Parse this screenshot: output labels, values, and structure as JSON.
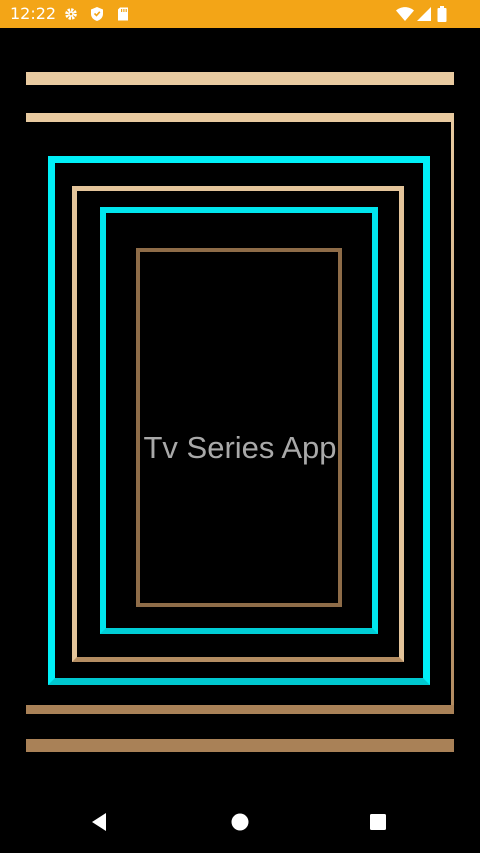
{
  "status_bar": {
    "time": "12:22",
    "background_color": "#f3a517",
    "left_icons": [
      "gear-icon",
      "shield-icon",
      "sd-card-icon"
    ],
    "right_icons": [
      "wifi-icon",
      "cell-signal-icon",
      "battery-icon"
    ]
  },
  "splash": {
    "app_title": "Tv Series App",
    "title_color": "#a9a9a9",
    "colors": {
      "cyan": "#00f0f8",
      "gold_light": "#e8caa0",
      "gold_dark": "#a98157",
      "brown": "#8a6a45",
      "background": "#000000"
    }
  },
  "nav_bar": {
    "buttons": [
      "back-icon",
      "home-icon",
      "recents-icon"
    ]
  }
}
